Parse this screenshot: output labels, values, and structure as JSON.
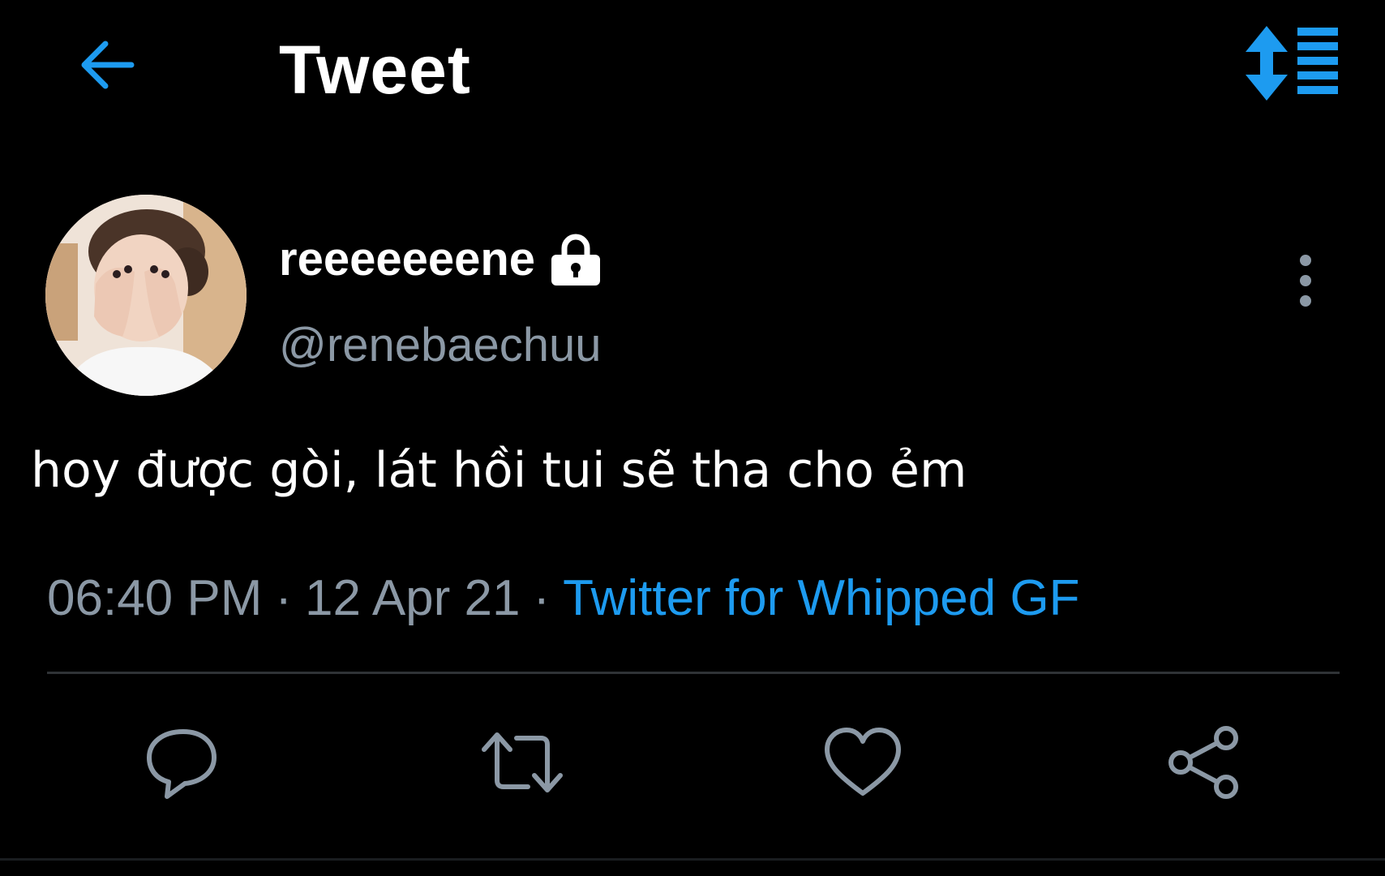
{
  "header": {
    "title": "Tweet",
    "back_icon": "arrow-left-icon",
    "sort_icon": "sort-up-down-list-icon"
  },
  "tweet": {
    "display_name": "reeeeeeene",
    "protected_icon": "lock-icon",
    "username": "@renebaechuu",
    "text": "hoy được gòi, lát hồi tui sẽ tha cho ẻm",
    "time": "06:40 PM",
    "date": "12 Apr 21",
    "separator": "·",
    "source": "Twitter for Whipped GF",
    "more_icon": "more-vertical-icon"
  },
  "actions": [
    {
      "name": "reply",
      "icon": "reply-bubble-icon"
    },
    {
      "name": "retweet",
      "icon": "retweet-icon"
    },
    {
      "name": "like",
      "icon": "heart-icon"
    },
    {
      "name": "share",
      "icon": "share-icon"
    }
  ],
  "colors": {
    "background": "#000000",
    "accent": "#1d9bf0",
    "muted_text": "#8b98a5",
    "icon_gray": "#8b98a5",
    "divider": "#2f3336"
  }
}
